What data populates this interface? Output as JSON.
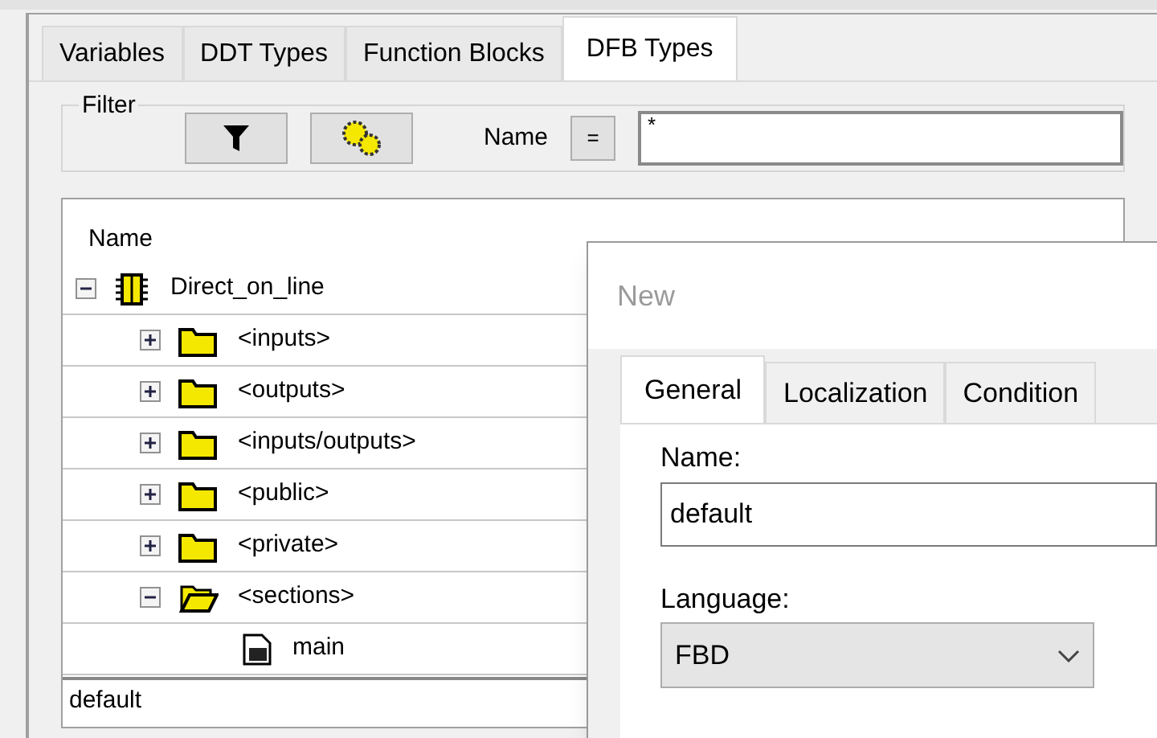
{
  "tabs": [
    {
      "label": "Variables",
      "selected": false
    },
    {
      "label": "DDT Types",
      "selected": false
    },
    {
      "label": "Function Blocks",
      "selected": false
    },
    {
      "label": "DFB Types",
      "selected": true
    }
  ],
  "filter": {
    "title": "Filter",
    "name_label": "Name",
    "operator": "=",
    "value": "*"
  },
  "table": {
    "columns": [
      "Name"
    ],
    "tree": [
      {
        "label": "Direct_on_line",
        "kind": "dfb",
        "expanded": true,
        "children": [
          {
            "label": "<inputs>",
            "kind": "folder",
            "expanded": false
          },
          {
            "label": "<outputs>",
            "kind": "folder",
            "expanded": false
          },
          {
            "label": "<inputs/outputs>",
            "kind": "folder",
            "expanded": false
          },
          {
            "label": "<public>",
            "kind": "folder",
            "expanded": false
          },
          {
            "label": "<private>",
            "kind": "folder",
            "expanded": false
          },
          {
            "label": "<sections>",
            "kind": "folder",
            "expanded": true,
            "children": [
              {
                "label": "main",
                "kind": "section"
              }
            ]
          }
        ]
      }
    ],
    "edit_value": "default"
  },
  "dialog": {
    "title": "New",
    "tabs": [
      {
        "label": "General",
        "selected": true
      },
      {
        "label": "Localization",
        "selected": false
      },
      {
        "label": "Condition",
        "selected": false
      }
    ],
    "name_label": "Name:",
    "name_value": "default",
    "language_label": "Language:",
    "language_value": "FBD"
  }
}
